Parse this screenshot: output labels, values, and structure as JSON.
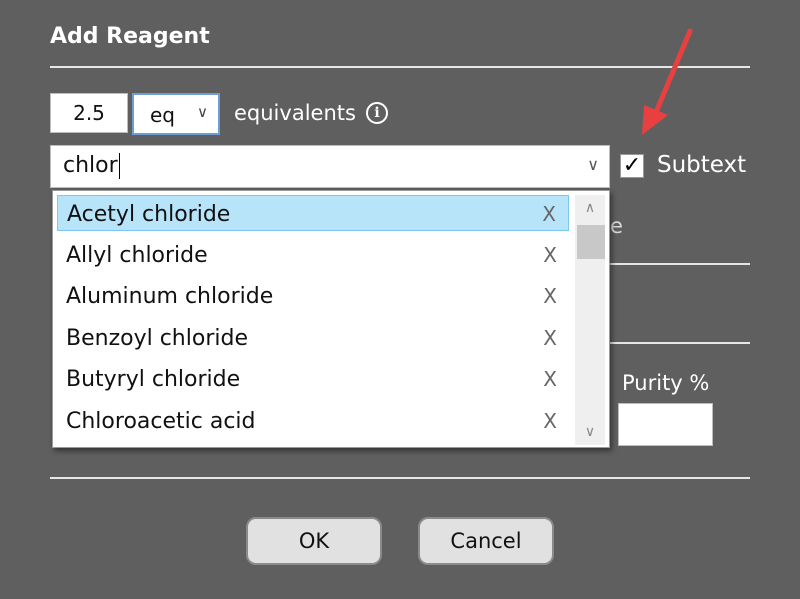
{
  "dialog": {
    "title": "Add Reagent"
  },
  "amount": {
    "value": "2.5",
    "unit": "eq",
    "unit_label": "equivalents",
    "info_icon": "info-icon"
  },
  "search": {
    "value": "chlor",
    "subtext_checked": true,
    "subtext_label": "Subtext"
  },
  "dropdown": {
    "remove_glyph": "X",
    "items": [
      {
        "label": "Acetyl chloride",
        "selected": true
      },
      {
        "label": "Allyl chloride"
      },
      {
        "label": "Aluminum chloride"
      },
      {
        "label": "Benzoyl chloride"
      },
      {
        "label": "Butyryl chloride"
      },
      {
        "label": "Chloroacetic acid"
      }
    ]
  },
  "hidden_field": {
    "partial_text": "e"
  },
  "purity": {
    "label": "Purity %",
    "value": ""
  },
  "buttons": {
    "ok": "OK",
    "cancel": "Cancel"
  },
  "colors": {
    "background": "#5f5f5f",
    "selection": "#b8e4f9",
    "arrow": "#e84040"
  }
}
